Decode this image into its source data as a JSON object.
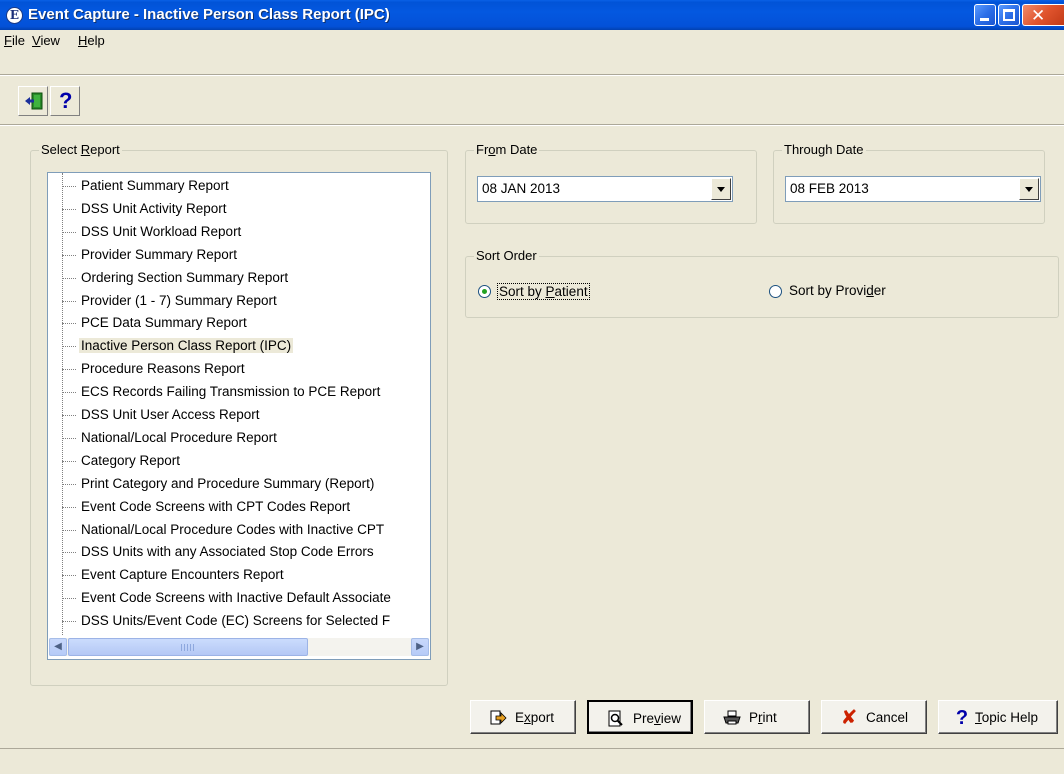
{
  "window": {
    "title": "Event Capture - Inactive Person Class Report (IPC)",
    "app_icon_glyph": "E"
  },
  "menu": {
    "items": [
      {
        "pre": "",
        "acc": "F",
        "post": "ile"
      },
      {
        "pre": "",
        "acc": "V",
        "post": "iew"
      },
      {
        "pre": "",
        "acc": "H",
        "post": "elp"
      }
    ]
  },
  "toolbar": {
    "exit_icon": "exit-door-icon",
    "help_glyph": "?"
  },
  "select_report": {
    "label_pre": "Select ",
    "label_acc": "R",
    "label_post": "eport",
    "selected_index": 7,
    "items": [
      "Patient Summary Report",
      "DSS Unit Activity Report",
      "DSS Unit Workload Report",
      "Provider Summary Report",
      "Ordering Section Summary Report",
      "Provider (1 - 7) Summary Report",
      "PCE Data Summary Report",
      "Inactive Person Class Report (IPC)",
      "Procedure Reasons Report",
      "ECS Records Failing Transmission to PCE Report",
      "DSS Unit User Access Report",
      "National/Local Procedure Report",
      "Category Report",
      "Print Category and Procedure Summary (Report)",
      "Event Code Screens with CPT Codes Report",
      "National/Local Procedure Codes with Inactive CPT",
      "DSS Units with any Associated Stop Code Errors",
      "Event Capture Encounters Report",
      "Event Code Screens with Inactive Default Associate",
      "DSS Units/Event Code (EC) Screens for Selected F"
    ]
  },
  "from_date": {
    "label_pre": "Fr",
    "label_acc": "o",
    "label_post": "m Date",
    "value": "08 JAN 2013"
  },
  "through_date": {
    "label": "Through Date",
    "value": "08 FEB 2013"
  },
  "sort_order": {
    "label": "Sort Order",
    "options": [
      {
        "pre": "Sort by ",
        "acc": "P",
        "post": "atient",
        "checked": true
      },
      {
        "pre": "Sort by Provi",
        "acc": "d",
        "post": "er",
        "checked": false
      }
    ]
  },
  "buttons": {
    "export": {
      "pre": "E",
      "acc": "x",
      "post": "port",
      "icon": "export-icon"
    },
    "preview": {
      "pre": "Pre",
      "acc": "v",
      "post": "iew",
      "icon": "preview-icon"
    },
    "print": {
      "pre": "P",
      "acc": "r",
      "post": "int",
      "icon": "printer-icon"
    },
    "cancel": {
      "pre": "Cancel",
      "acc": "",
      "post": "",
      "icon": "x-icon"
    },
    "topic_help": {
      "pre": "",
      "acc": "T",
      "post": "opic Help",
      "icon": "question-icon"
    }
  },
  "colors": {
    "titlebar": "#0458e0",
    "window_bg": "#ece9d8",
    "cancel_icon": "#cc2200",
    "help_icon": "#0000aa"
  }
}
